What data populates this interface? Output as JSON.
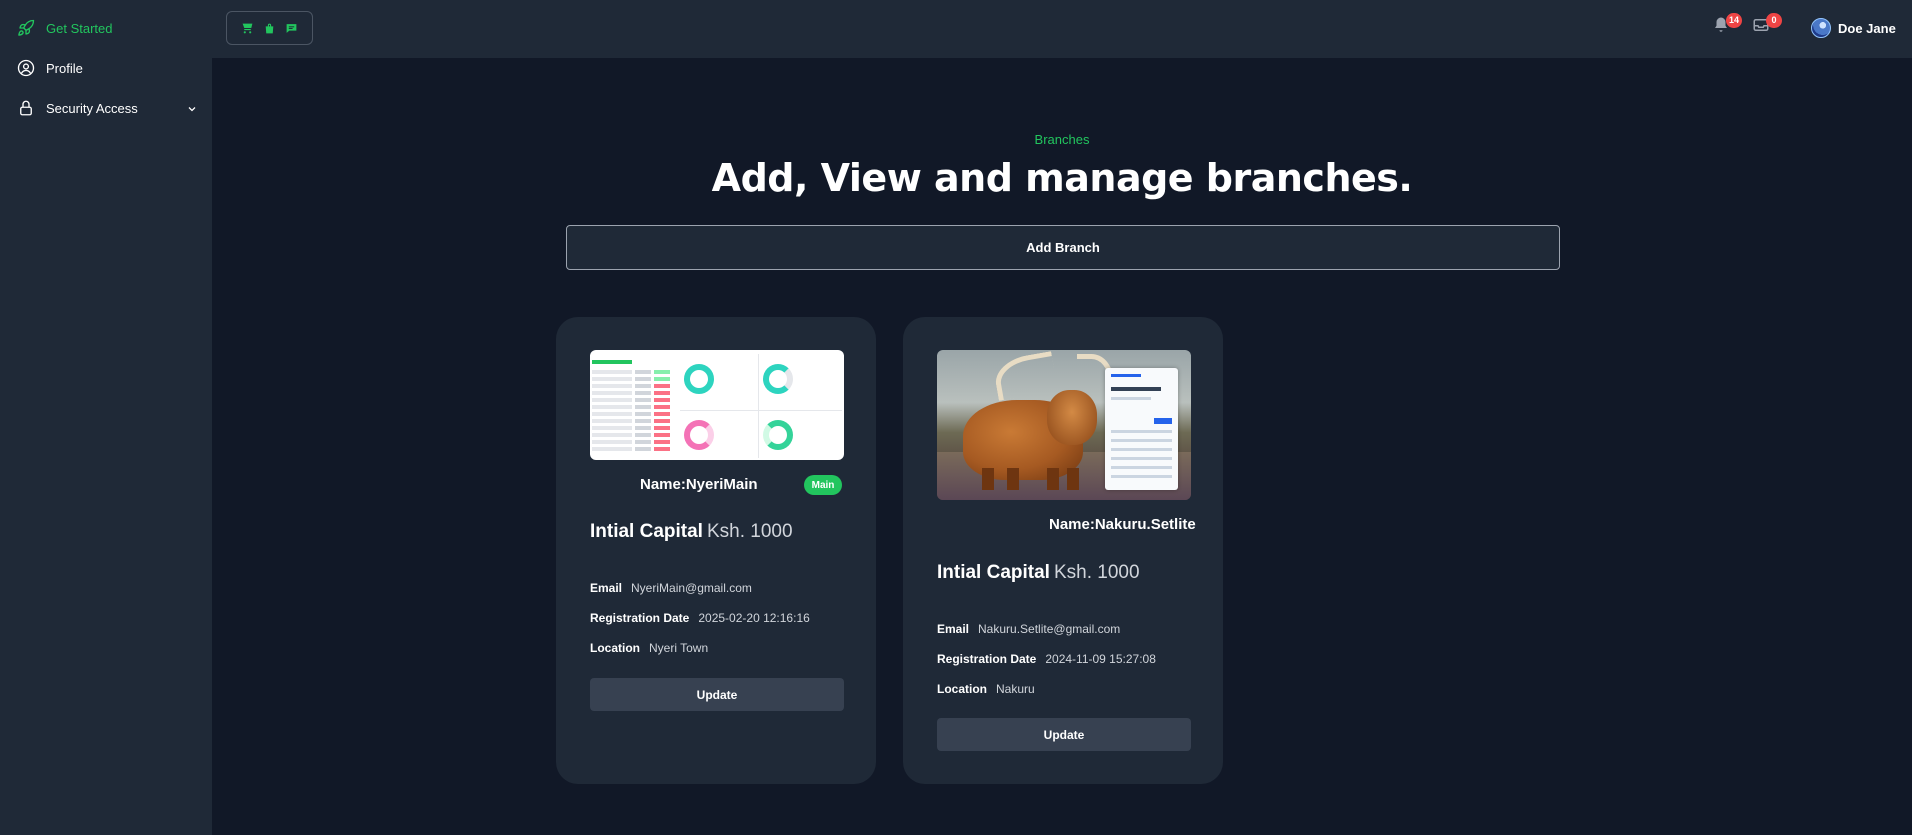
{
  "sidebar": {
    "items": [
      {
        "label": "Get Started",
        "icon": "rocket-icon",
        "active": true
      },
      {
        "label": "Profile",
        "icon": "user-circle-icon",
        "active": false
      },
      {
        "label": "Security Access",
        "icon": "lock-icon",
        "active": false
      }
    ]
  },
  "topbar": {
    "quick_actions": [
      "store-icon",
      "bag-icon",
      "chat-icon"
    ],
    "notifications_count": "14",
    "messages_count": "0",
    "user_name": "Doe Jane"
  },
  "main": {
    "section_label": "Branches",
    "title": "Add, View and manage branches.",
    "add_button": "Add Branch",
    "capital_label": "Intial Capital",
    "email_label": "Email",
    "regdate_label": "Registration Date",
    "location_label": "Location",
    "update_label": "Update",
    "branches": [
      {
        "name": "Name:NyeriMain",
        "badge": "Main",
        "capital": "Ksh. 1000",
        "email": "NyeriMain@gmail.com",
        "reg_date": "2025-02-20 12:16:16",
        "location": "Nyeri Town"
      },
      {
        "name": "Name:Nakuru.Setlite",
        "capital": "Ksh. 1000",
        "email": "Nakuru.Setlite@gmail.com",
        "reg_date": "2024-11-09 15:27:08",
        "location": "Nakuru"
      }
    ]
  },
  "colors": {
    "accent": "#22c55e",
    "background": "#111827",
    "panel": "#1f2937",
    "badge_red": "#ef4444"
  }
}
